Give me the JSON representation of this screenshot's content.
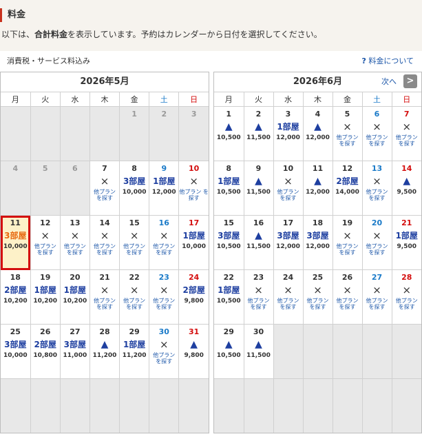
{
  "header": {
    "title": "料金"
  },
  "description": {
    "before": "以下は、",
    "bold": "合計料金",
    "after": "を表示しています。予約はカレンダーから日付を選択してください。"
  },
  "tax_note": "消費税・サービス料込み",
  "about_link": {
    "q": "?",
    "label": "料金について"
  },
  "weekdays": [
    "月",
    "火",
    "水",
    "木",
    "金",
    "土",
    "日"
  ],
  "next": {
    "label": "次へ",
    "icon": ">"
  },
  "other_plan": "他プラン を探す",
  "calendars": [
    {
      "title": "2026年5月",
      "days": [
        {
          "t": "empty"
        },
        {
          "t": "empty"
        },
        {
          "t": "empty"
        },
        {
          "t": "empty"
        },
        {
          "t": "past",
          "d": "1"
        },
        {
          "t": "past",
          "d": "2"
        },
        {
          "t": "past",
          "d": "3"
        },
        {
          "t": "past",
          "d": "4"
        },
        {
          "t": "past",
          "d": "5"
        },
        {
          "t": "past",
          "d": "6"
        },
        {
          "t": "day",
          "d": "7",
          "s": "×",
          "o": true
        },
        {
          "t": "day",
          "d": "8",
          "s": "3部屋",
          "p": "10,000"
        },
        {
          "t": "day",
          "d": "9",
          "s": "1部屋",
          "p": "12,000"
        },
        {
          "t": "day",
          "d": "10",
          "s": "×",
          "o": true
        },
        {
          "t": "day",
          "d": "11",
          "s": "3部屋",
          "p": "10,000",
          "sel": true
        },
        {
          "t": "day",
          "d": "12",
          "s": "×",
          "o": true
        },
        {
          "t": "day",
          "d": "13",
          "s": "×",
          "o": true
        },
        {
          "t": "day",
          "d": "14",
          "s": "×",
          "o": true
        },
        {
          "t": "day",
          "d": "15",
          "s": "×",
          "o": true
        },
        {
          "t": "day",
          "d": "16",
          "s": "×",
          "o": true
        },
        {
          "t": "day",
          "d": "17",
          "s": "1部屋",
          "p": "10,000"
        },
        {
          "t": "day",
          "d": "18",
          "s": "2部屋",
          "p": "10,200"
        },
        {
          "t": "day",
          "d": "19",
          "s": "1部屋",
          "p": "10,200"
        },
        {
          "t": "day",
          "d": "20",
          "s": "1部屋",
          "p": "10,200"
        },
        {
          "t": "day",
          "d": "21",
          "s": "×",
          "o": true
        },
        {
          "t": "day",
          "d": "22",
          "s": "×",
          "o": true
        },
        {
          "t": "day",
          "d": "23",
          "s": "×",
          "o": true
        },
        {
          "t": "day",
          "d": "24",
          "s": "2部屋",
          "p": "9,800"
        },
        {
          "t": "day",
          "d": "25",
          "s": "3部屋",
          "p": "10,000"
        },
        {
          "t": "day",
          "d": "26",
          "s": "2部屋",
          "p": "10,800"
        },
        {
          "t": "day",
          "d": "27",
          "s": "3部屋",
          "p": "11,000"
        },
        {
          "t": "day",
          "d": "28",
          "s": "▲",
          "p": "11,200"
        },
        {
          "t": "day",
          "d": "29",
          "s": "1部屋",
          "p": "11,200"
        },
        {
          "t": "day",
          "d": "30",
          "s": "×",
          "o": true
        },
        {
          "t": "day",
          "d": "31",
          "s": "▲",
          "p": "9,800"
        },
        {
          "t": "empty"
        },
        {
          "t": "empty"
        },
        {
          "t": "empty"
        },
        {
          "t": "empty"
        },
        {
          "t": "empty"
        },
        {
          "t": "empty"
        },
        {
          "t": "empty"
        }
      ]
    },
    {
      "title": "2026年6月",
      "days": [
        {
          "t": "day",
          "d": "1",
          "s": "▲",
          "p": "10,500"
        },
        {
          "t": "day",
          "d": "2",
          "s": "▲",
          "p": "11,500"
        },
        {
          "t": "day",
          "d": "3",
          "s": "1部屋",
          "p": "12,000"
        },
        {
          "t": "day",
          "d": "4",
          "s": "▲",
          "p": "12,000"
        },
        {
          "t": "day",
          "d": "5",
          "s": "×",
          "o": true
        },
        {
          "t": "day",
          "d": "6",
          "s": "×",
          "o": true
        },
        {
          "t": "day",
          "d": "7",
          "s": "×",
          "o": true
        },
        {
          "t": "day",
          "d": "8",
          "s": "1部屋",
          "p": "10,500"
        },
        {
          "t": "day",
          "d": "9",
          "s": "▲",
          "p": "11,500"
        },
        {
          "t": "day",
          "d": "10",
          "s": "×",
          "o": true
        },
        {
          "t": "day",
          "d": "11",
          "s": "▲",
          "p": "12,000"
        },
        {
          "t": "day",
          "d": "12",
          "s": "2部屋",
          "p": "14,000"
        },
        {
          "t": "day",
          "d": "13",
          "s": "×",
          "o": true
        },
        {
          "t": "day",
          "d": "14",
          "s": "▲",
          "p": "9,500"
        },
        {
          "t": "day",
          "d": "15",
          "s": "3部屋",
          "p": "10,500"
        },
        {
          "t": "day",
          "d": "16",
          "s": "▲",
          "p": "11,500"
        },
        {
          "t": "day",
          "d": "17",
          "s": "3部屋",
          "p": "12,000"
        },
        {
          "t": "day",
          "d": "18",
          "s": "3部屋",
          "p": "12,000"
        },
        {
          "t": "day",
          "d": "19",
          "s": "×",
          "o": true
        },
        {
          "t": "day",
          "d": "20",
          "s": "×",
          "o": true
        },
        {
          "t": "day",
          "d": "21",
          "s": "1部屋",
          "p": "9,500"
        },
        {
          "t": "day",
          "d": "22",
          "s": "1部屋",
          "p": "10,500"
        },
        {
          "t": "day",
          "d": "23",
          "s": "×",
          "o": true
        },
        {
          "t": "day",
          "d": "24",
          "s": "×",
          "o": true
        },
        {
          "t": "day",
          "d": "25",
          "s": "×",
          "o": true
        },
        {
          "t": "day",
          "d": "26",
          "s": "×",
          "o": true
        },
        {
          "t": "day",
          "d": "27",
          "s": "×",
          "o": true
        },
        {
          "t": "day",
          "d": "28",
          "s": "×",
          "o": true
        },
        {
          "t": "day",
          "d": "29",
          "s": "▲",
          "p": "10,500"
        },
        {
          "t": "day",
          "d": "30",
          "s": "▲",
          "p": "11,500"
        },
        {
          "t": "empty"
        },
        {
          "t": "empty"
        },
        {
          "t": "empty"
        },
        {
          "t": "empty"
        },
        {
          "t": "empty"
        },
        {
          "t": "empty"
        },
        {
          "t": "empty"
        },
        {
          "t": "empty"
        },
        {
          "t": "empty"
        },
        {
          "t": "empty"
        },
        {
          "t": "empty"
        },
        {
          "t": "empty"
        }
      ]
    }
  ],
  "colors": {
    "accent": "#c8321e",
    "link": "#1a55a8",
    "status": "#1e3fa0",
    "selected_border": "#d40e0e",
    "selected_bg": "#fdf1c8",
    "sat": "#1a7ac8",
    "sun": "#d40e0e"
  }
}
